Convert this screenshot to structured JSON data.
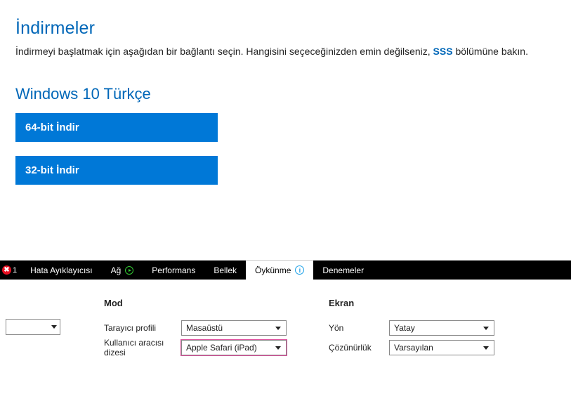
{
  "page": {
    "heading": "İndirmeler",
    "desc_pre": "İndirmeyi başlatmak için aşağıdan bir bağlantı seçin. Hangisini seçeceğinizden emin değilseniz, ",
    "desc_link": "SSS",
    "desc_post": " bölümüne bakın.",
    "subheading": "Windows 10 Türkçe",
    "download_64": "64-bit İndir",
    "download_32": "32-bit İndir"
  },
  "devtools": {
    "error_count": "1",
    "tabs": {
      "debugger": "Hata Ayıklayıcısı",
      "network": "Ağ",
      "performance": "Performans",
      "memory": "Bellek",
      "emulation": "Öykünme",
      "experiments": "Denemeler"
    },
    "info_glyph": "i"
  },
  "emulation": {
    "mode": {
      "title": "Mod",
      "browser_profile_label": "Tarayıcı profili",
      "browser_profile_value": "Masaüstü",
      "ua_string_label": "Kullanıcı aracısı dizesi",
      "ua_string_value": "Apple Safari (iPad)"
    },
    "screen": {
      "title": "Ekran",
      "orientation_label": "Yön",
      "orientation_value": "Yatay",
      "resolution_label": "Çözünürlük",
      "resolution_value": "Varsayılan"
    }
  }
}
